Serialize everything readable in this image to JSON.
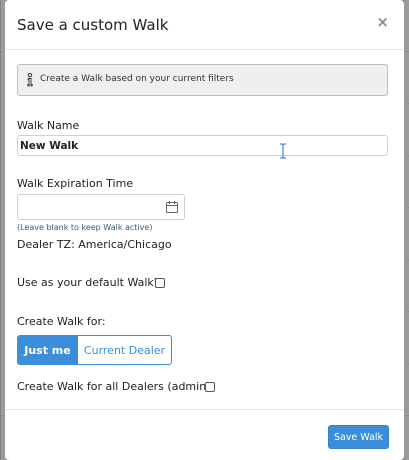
{
  "modal": {
    "title": "Save a custom Walk",
    "close_label": "×"
  },
  "info": {
    "icon": "info-icon",
    "text": "Create a Walk based on your current filters"
  },
  "walk_name": {
    "label": "Walk Name",
    "value": "New Walk"
  },
  "expiration": {
    "label": "Walk Expiration Time",
    "value": "",
    "icon": "calendar-icon",
    "hint": "(Leave blank to keep Walk active)",
    "timezone": "Dealer TZ: America/Chicago"
  },
  "default_walk": {
    "label": "Use as your default Walk?",
    "checked": false
  },
  "create_for": {
    "label": "Create Walk for:",
    "options": [
      "Just me",
      "Current Dealer"
    ],
    "selected": "Just me"
  },
  "all_dealers": {
    "label": "Create Walk for all Dealers (admin)",
    "checked": false
  },
  "footer": {
    "save_label": "Save Walk"
  },
  "colors": {
    "primary": "#3c8edb",
    "hint": "#2b5f86",
    "backdrop": "#9b9b9b"
  }
}
